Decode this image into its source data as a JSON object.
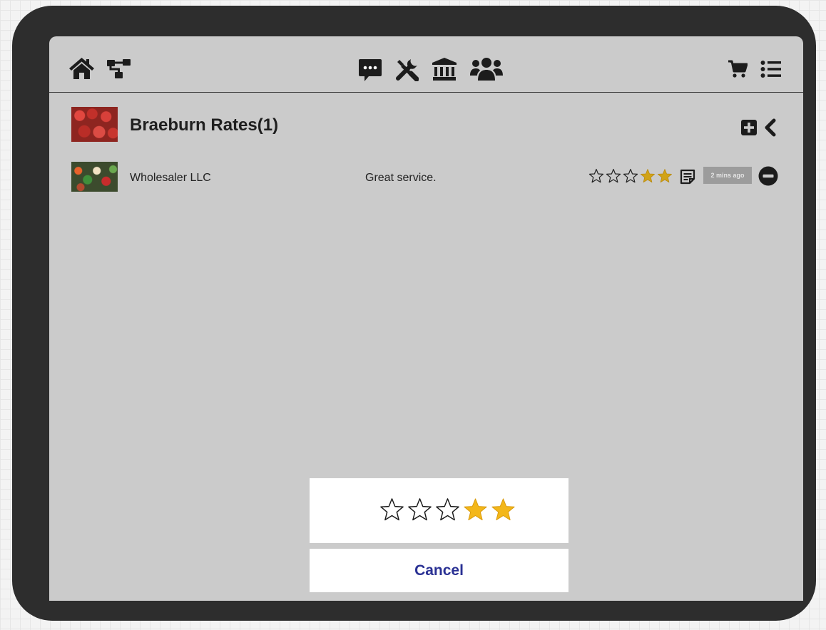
{
  "app": {
    "nav_left": [
      {
        "icon": "home-icon"
      },
      {
        "icon": "hierarchy-icon"
      }
    ],
    "nav_center": [
      {
        "icon": "chat-icon"
      },
      {
        "icon": "tools-icon"
      },
      {
        "icon": "bank-icon"
      },
      {
        "icon": "users-icon"
      }
    ],
    "nav_right": [
      {
        "icon": "cart-icon"
      },
      {
        "icon": "list-icon"
      }
    ]
  },
  "header": {
    "title": "Braeburn Rates(1)",
    "thumbnail": "apples-image"
  },
  "ratings": [
    {
      "name": "Wholesaler LLC",
      "comment": "Great service.",
      "stars": 2,
      "max_stars": 5,
      "timestamp": "2 mins ago",
      "thumbnail": "vegetables-image"
    }
  ],
  "rating_picker": {
    "stars": 2,
    "max_stars": 5,
    "cancel_label": "Cancel"
  },
  "colors": {
    "star_small": "#d1a318",
    "star_big": "#f3b71a",
    "cancel_text": "#2a3194"
  }
}
